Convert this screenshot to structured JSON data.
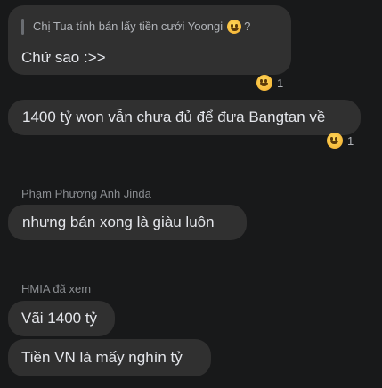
{
  "messages": [
    {
      "reply_quote": "Chị Tua tính bán lấy tiền cưới Yoongi",
      "reply_icon": "grinning-emoji-icon",
      "reply_suffix": "?",
      "text": "Chứ sao :>>",
      "reaction_icon": "grinning-emoji-icon",
      "reaction_count": "1"
    },
    {
      "text": "1400 tỷ won vẫn chưa đủ để đưa Bangtan về",
      "reaction_icon": "grinning-emoji-icon",
      "reaction_count": "1"
    },
    {
      "sender": "Phạm Phương Anh Jinda",
      "text": "nhưng bán xong là giàu luôn"
    },
    {
      "sender": "HMIA đã xem",
      "text": "Vãi 1400 tỷ"
    },
    {
      "text": "Tiền VN là mấy nghìn tỷ"
    }
  ],
  "colors": {
    "background": "#18191a",
    "bubble": "#303030",
    "text": "#e4e6eb",
    "muted": "#8a8d91"
  }
}
